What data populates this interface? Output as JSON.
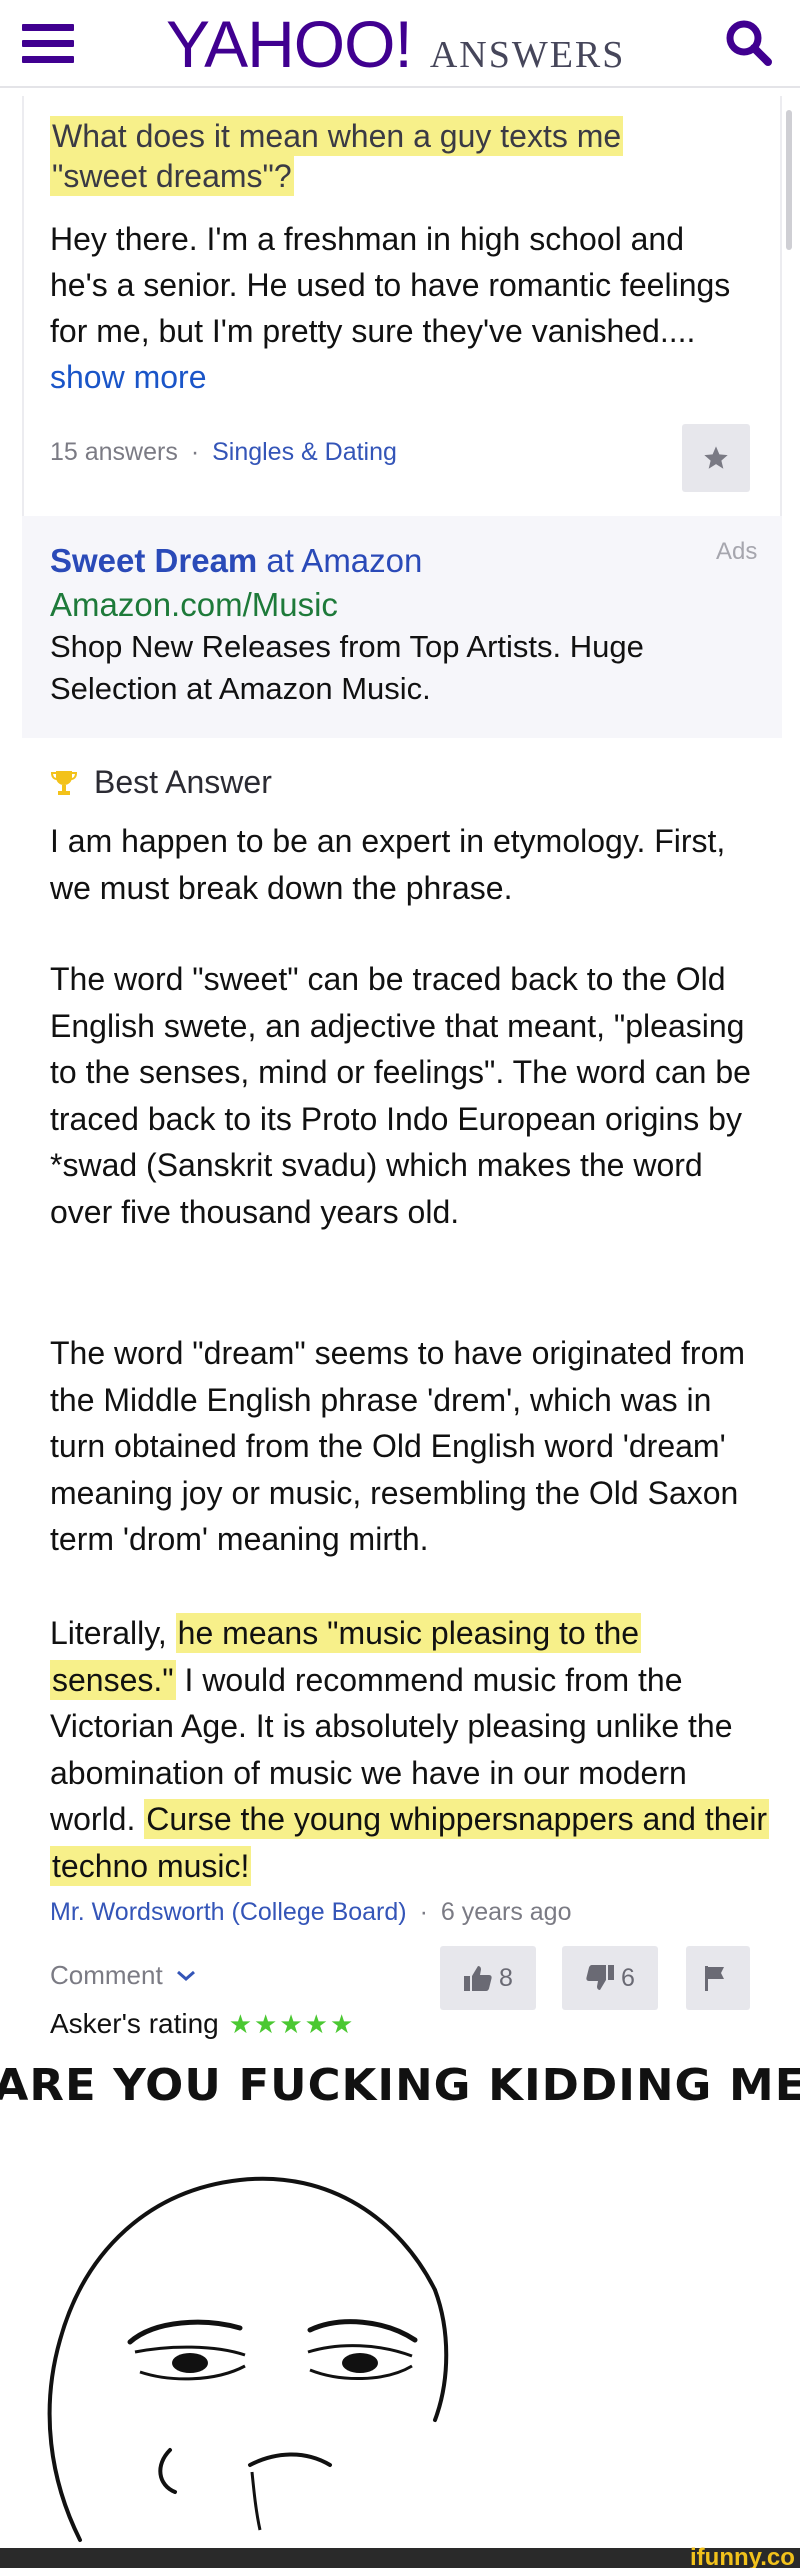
{
  "header": {
    "brand_yahoo": "YAHOO!",
    "brand_answers": "ANSWERS",
    "menu_icon": "hamburger-menu-icon",
    "search_icon": "search-icon",
    "brand_color": "#400090"
  },
  "question": {
    "title_line1": "What does it mean when a guy texts me",
    "title_line2": "\"sweet dreams\"?",
    "body": "Hey there. I'm a freshman in high school and he's a senior. He used to have romantic feelings for me, but I'm pretty sure they've vanished....",
    "show_more": "show more",
    "answers_count": "15 answers",
    "separator": "·",
    "category": "Singles & Dating",
    "star_icon": "star-icon"
  },
  "ad": {
    "tag": "Ads",
    "title_bold": "Sweet Dream",
    "title_rest": " at Amazon",
    "url": "Amazon.com/Music",
    "description": "Shop New Releases from Top Artists. Huge Selection at Amazon Music."
  },
  "answer": {
    "best_label": "Best Answer",
    "trophy_icon": "trophy-icon",
    "p1": "I am happen to be an expert in etymology. First, we must break down the phrase.",
    "p2": "The word \"sweet\" can be traced back to the Old English swete, an adjective that meant, \"pleasing to the senses, mind or feelings\". The word can be traced back to its Proto Indo European origins by *swad (Sanskrit svadu) which makes the word over five thousand years old.",
    "p3": "The word \"dream\" seems to have originated from the Middle English phrase 'drem', which was in turn obtained from the Old English word 'dream' meaning joy or music, resembling the Old Saxon term 'drom' meaning mirth.",
    "p4_a": "Literally, ",
    "p4_hl1": "he means \"music pleasing to the senses.\"",
    "p4_b": " I would recommend music from the Victorian Age. It is absolutely pleasing unlike the abomination of music we have in our modern world. ",
    "p4_hl2": "Curse the young whippersnappers and their techno music!",
    "author_name": "Mr. Wordsworth (College Board)",
    "author_sep": "·",
    "author_time": "6 years ago",
    "comment_label": "Comment",
    "thumbs_up_count": "8",
    "thumbs_down_count": "6",
    "rating_label": "Asker's rating",
    "rating_stars": "★★★★★",
    "rating_value": 5
  },
  "meme": {
    "caption": "ARE YOU FUCKING KIDDING ME",
    "watermark": "ifunny.co"
  }
}
